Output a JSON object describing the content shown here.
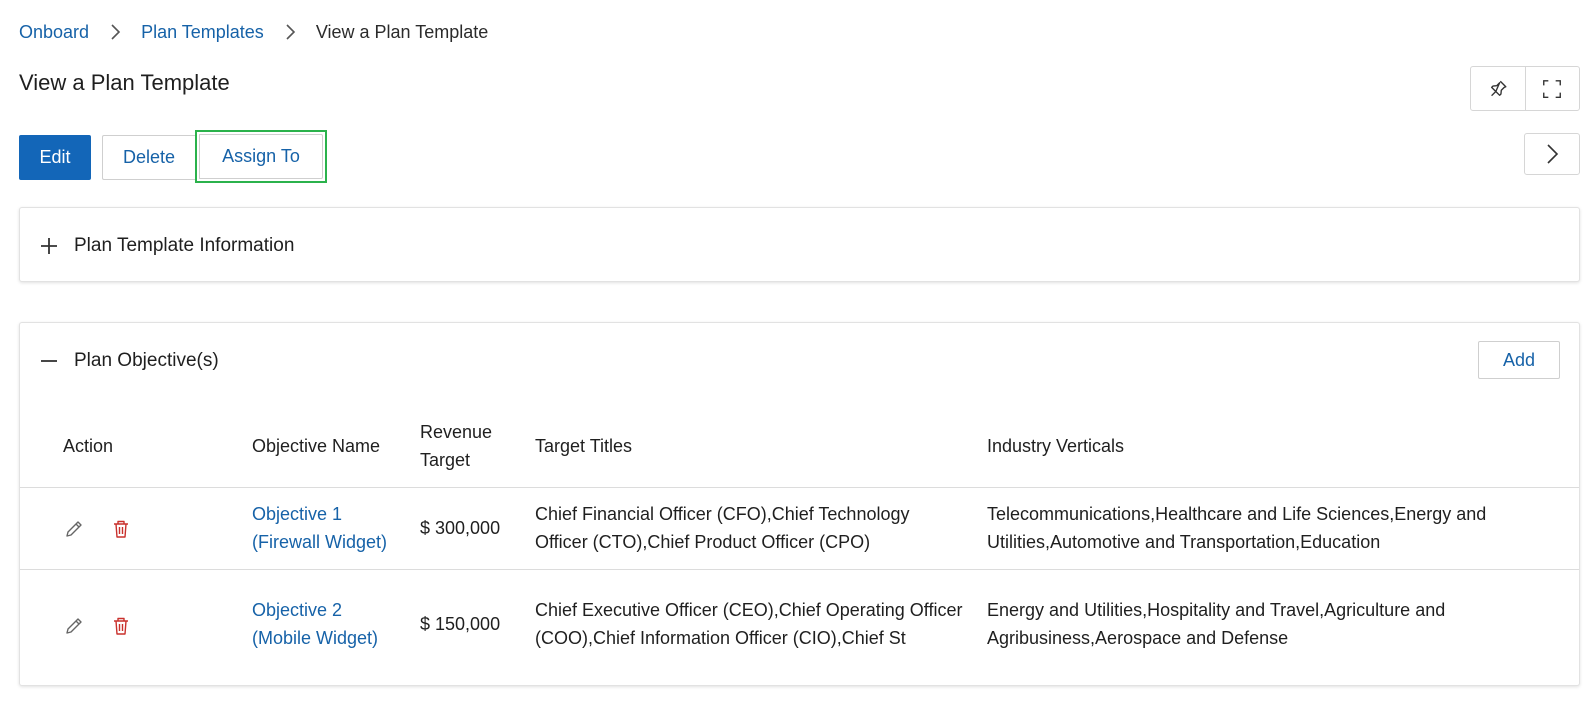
{
  "breadcrumb": {
    "items": [
      "Onboard",
      "Plan Templates"
    ],
    "current": "View a Plan Template"
  },
  "page": {
    "title": "View a Plan Template"
  },
  "toolbar": {
    "edit_label": "Edit",
    "delete_label": "Delete",
    "assign_label": "Assign To"
  },
  "icons": {
    "pin": "pin-icon",
    "fullscreen": "fullscreen-icon",
    "next": "chevron-right-icon",
    "expand": "plus-icon",
    "collapse": "minus-icon",
    "edit": "pencil-icon",
    "delete": "trash-icon"
  },
  "colors": {
    "primary": "#1366b8",
    "link": "#1662a8",
    "highlight": "#2bb24c",
    "danger": "#c9302c"
  },
  "info_panel": {
    "title": "Plan Template Information"
  },
  "objectives_panel": {
    "title": "Plan Objective(s)",
    "add_label": "Add",
    "columns": {
      "action": "Action",
      "name": "Objective Name",
      "revenue_1": "Revenue",
      "revenue_2": "Target",
      "titles": "Target Titles",
      "industry": "Industry Verticals"
    },
    "rows": [
      {
        "name_1": "Objective 1",
        "name_2": "(Firewall Widget)",
        "revenue": "$ 300,000",
        "titles": "Chief Financial Officer (CFO),Chief Technology Officer (CTO),Chief Product Officer (CPO)",
        "industry": "Telecommunications,Healthcare and Life Sciences,Energy and Utilities,Automotive and Transportation,Education"
      },
      {
        "name_1": "Objective 2",
        "name_2": "(Mobile Widget)",
        "revenue": "$ 150,000",
        "titles": "Chief Executive Officer (CEO),Chief Operating Officer (COO),Chief Information Officer (CIO),Chief St",
        "industry": "Energy and Utilities,Hospitality and Travel,Agriculture and Agribusiness,Aerospace and Defense"
      }
    ]
  }
}
